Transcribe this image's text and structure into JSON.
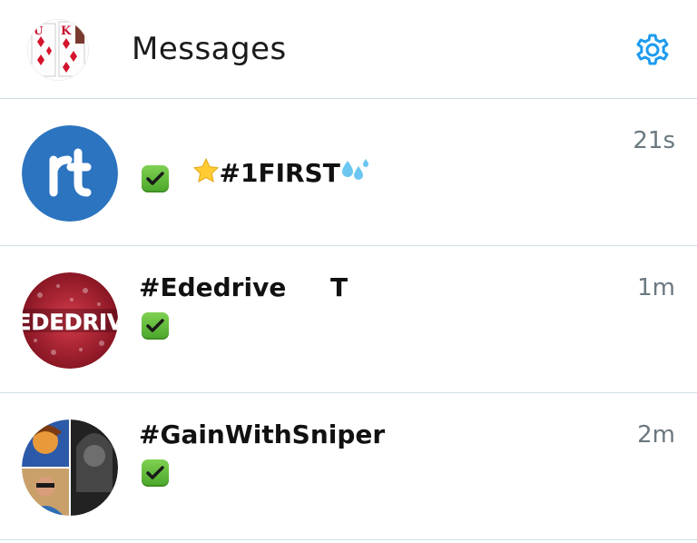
{
  "header": {
    "title": "Messages",
    "avatar_icon": "playing-cards-avatar",
    "settings_icon": "gear-icon"
  },
  "colors": {
    "accent": "#1d9bf0",
    "divider": "#cfdde2",
    "time_text": "#6b7880",
    "check_green": "#4aa62a",
    "rt_blue": "#2c74c0"
  },
  "conversations": [
    {
      "name": "#1FIRST",
      "time": "21s",
      "status_icon": "green-check-icon",
      "avatar_icon": "rt-logo-avatar",
      "prefix_emoji": "star-icon",
      "suffix_emoji": "droplets-icon"
    },
    {
      "name": "#Ededrive     T",
      "time": "1m",
      "status_icon": "green-check-icon",
      "avatar_icon": "ededrive-avatar",
      "avatar_text": "EDEDRIV"
    },
    {
      "name": "#GainWithSniper",
      "time": "2m",
      "status_icon": "green-check-icon",
      "avatar_icon": "group-avatar"
    }
  ]
}
